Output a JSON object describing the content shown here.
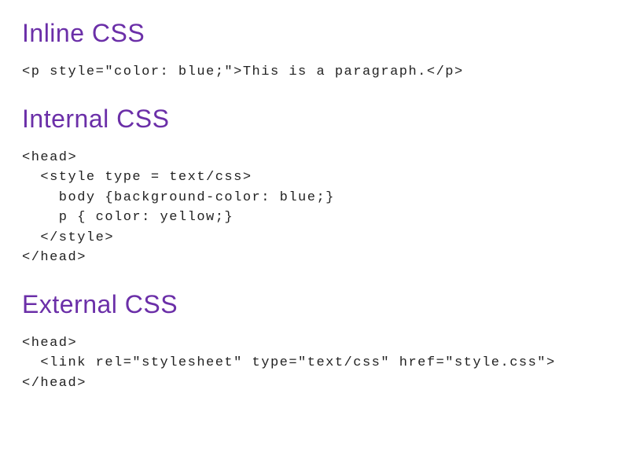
{
  "sections": [
    {
      "heading": "Inline CSS",
      "code": "<p style=\"color: blue;\">This is a paragraph.</p>"
    },
    {
      "heading": "Internal CSS",
      "code": "<head>\n  <style type = text/css>\n    body {background-color: blue;}\n    p { color: yellow;}\n  </style>\n</head>"
    },
    {
      "heading": "External CSS",
      "code": "<head>\n  <link rel=\"stylesheet\" type=\"text/css\" href=\"style.css\">\n</head>"
    }
  ]
}
